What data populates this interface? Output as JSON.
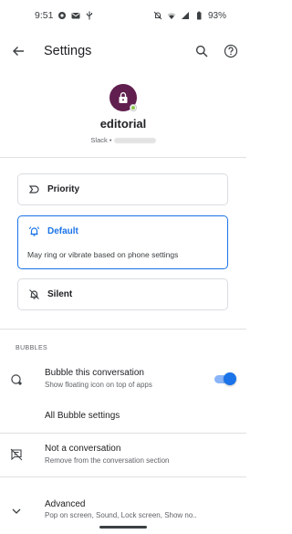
{
  "status_bar": {
    "time": "9:51",
    "battery": "93%",
    "left_icons": [
      "settings-icon",
      "mail-icon",
      "usb-icon"
    ],
    "right_icons": [
      "mute-icon",
      "wifi-icon",
      "signal-icon",
      "battery-icon"
    ]
  },
  "app_bar": {
    "title": "Settings",
    "icons": [
      "back-arrow-icon",
      "search-icon",
      "help-icon"
    ]
  },
  "conversation": {
    "name": "editorial",
    "app": "Slack •"
  },
  "priority_options": [
    {
      "label": "Priority",
      "icon": "priority-icon",
      "selected": false
    },
    {
      "label": "Default",
      "icon": "bell-ring-icon",
      "selected": true,
      "description": "May ring or vibrate based on phone settings"
    },
    {
      "label": "Silent",
      "icon": "bell-off-icon",
      "selected": false
    }
  ],
  "bubbles_section": {
    "header": "BUBBLES",
    "bubble_conversation": {
      "title": "Bubble this conversation",
      "subtitle": "Show floating icon on top of apps",
      "enabled": true
    },
    "all_bubble_settings": "All Bubble settings"
  },
  "not_conversation": {
    "title": "Not a conversation",
    "subtitle": "Remove from the conversation section"
  },
  "advanced": {
    "title": "Advanced",
    "subtitle": "Pop on screen, Sound, Lock screen, Show no.."
  },
  "colors": {
    "accent": "#1a73e8",
    "avatar": "#611f4f"
  }
}
